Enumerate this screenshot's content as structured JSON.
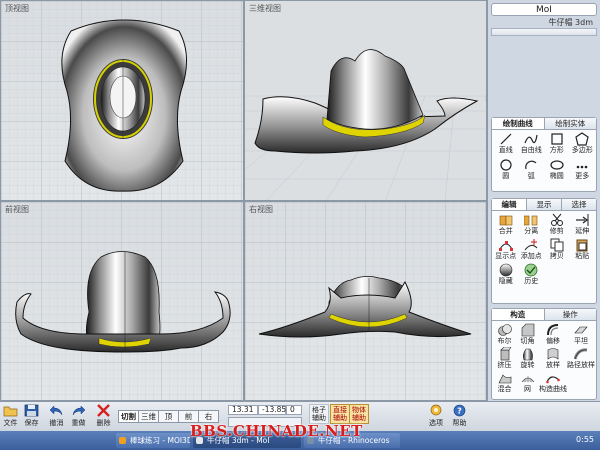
{
  "viewports": {
    "top": {
      "title": "顶视图"
    },
    "perspective": {
      "title": "三维视图"
    },
    "front": {
      "title": "前视图"
    },
    "right": {
      "title": "右视图"
    }
  },
  "panel": {
    "logo": "MoI",
    "file_name": "牛仔帽 3dm",
    "draw_tabs": [
      "绘制曲线",
      "绘制实体"
    ],
    "draw_tools": [
      {
        "label": "直线",
        "icon": "line-icon"
      },
      {
        "label": "自由线",
        "icon": "freeform-curve-icon"
      },
      {
        "label": "方形",
        "icon": "rectangle-icon"
      },
      {
        "label": "多边形",
        "icon": "polygon-icon"
      },
      {
        "label": "圆",
        "icon": "circle-icon"
      },
      {
        "label": "弧",
        "icon": "arc-icon"
      },
      {
        "label": "椭圆",
        "icon": "ellipse-icon"
      },
      {
        "label": "更多",
        "icon": "more-icon"
      }
    ],
    "edit_tabs": [
      "编辑",
      "显示",
      "选择"
    ],
    "edit_tools": [
      {
        "label": "合并",
        "icon": "join-icon"
      },
      {
        "label": "分离",
        "icon": "separate-icon"
      },
      {
        "label": "修剪",
        "icon": "trim-icon"
      },
      {
        "label": "延伸",
        "icon": "extend-icon"
      },
      {
        "label": "显示点",
        "icon": "show-points-icon"
      },
      {
        "label": "添加点",
        "icon": "add-point-icon"
      },
      {
        "label": "拷贝",
        "icon": "copy-icon"
      },
      {
        "label": "粘贴",
        "icon": "paste-icon"
      },
      {
        "label": "隐藏",
        "icon": "hide-icon"
      },
      {
        "label": "历史",
        "icon": "history-icon"
      }
    ],
    "construct_tabs": [
      "构造",
      "操作"
    ],
    "construct_tools": [
      {
        "label": "布尔",
        "icon": "boolean-icon"
      },
      {
        "label": "切角",
        "icon": "chamfer-icon"
      },
      {
        "label": "偏移",
        "icon": "offset-icon"
      },
      {
        "label": "平坦",
        "icon": "planar-icon"
      },
      {
        "label": "挤压",
        "icon": "extrude-icon"
      },
      {
        "label": "旋转",
        "icon": "revolve-icon"
      },
      {
        "label": "放样",
        "icon": "loft-icon"
      },
      {
        "label": "路径放样",
        "icon": "sweep-icon"
      },
      {
        "label": "混合",
        "icon": "blend-icon"
      },
      {
        "label": "网",
        "icon": "network-icon"
      },
      {
        "label": "构造曲线",
        "icon": "construct-curve-icon"
      }
    ]
  },
  "toolbar": {
    "file": "文件",
    "save": "保存",
    "undo": "撤消",
    "redo": "重做",
    "delete": "删除",
    "view_tabs": [
      "切割",
      "三维",
      "顶",
      "前",
      "右"
    ],
    "active_view": 0,
    "coord_x": "13.31",
    "coord_y": "-13.85",
    "coord_z": "0",
    "grid_snap": "格子\n辅助",
    "straight_snap": "直接\n辅助",
    "object_snap": "物体\n辅助",
    "options": "选项",
    "help": "帮助"
  },
  "taskbar": {
    "tasks": [
      "棒球练习 - MOI3D...",
      "牛仔帽 3dm - MoI",
      "牛仔帽 - Rhinoceros"
    ],
    "clock": "0:55"
  },
  "watermark": "BBS.CHINADE.NET"
}
